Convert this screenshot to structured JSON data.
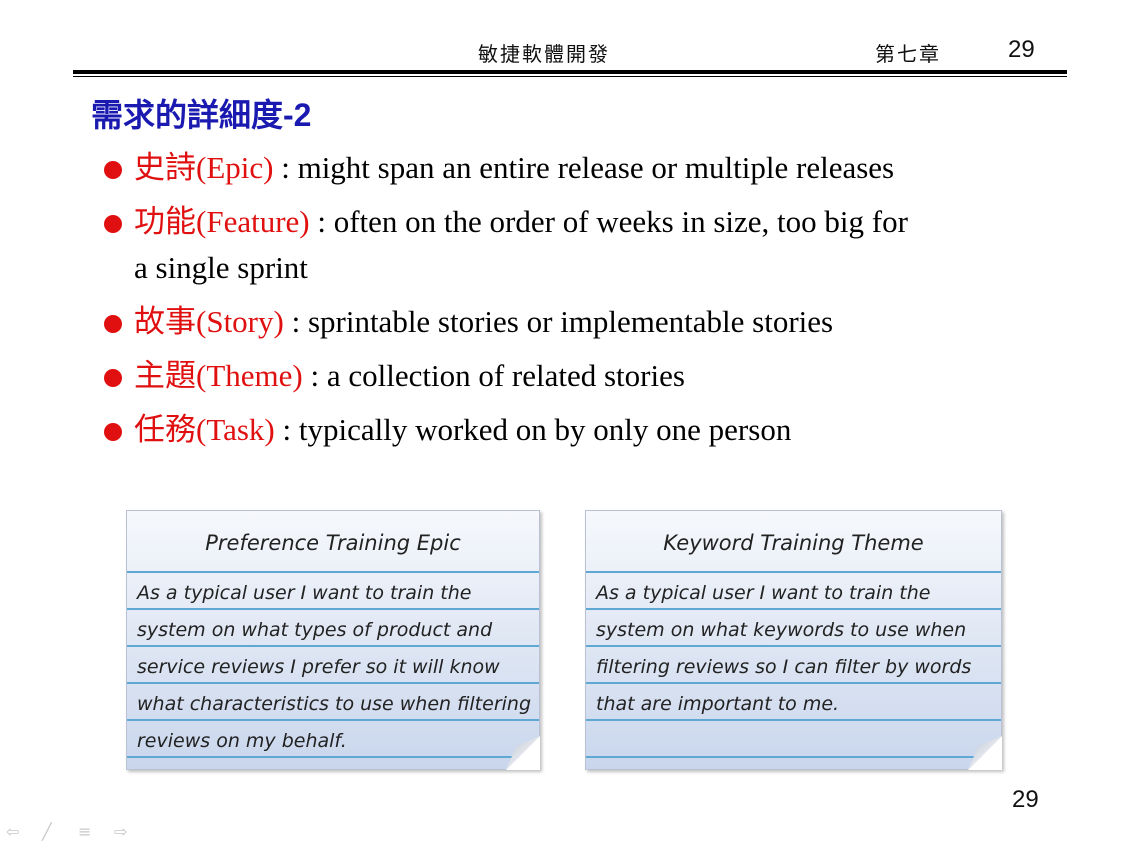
{
  "header": {
    "course_title": "敏捷軟體開發",
    "chapter": "第七章",
    "page_number": "29"
  },
  "slide": {
    "title_text": "需求的詳細度",
    "title_suffix": "-2",
    "bullets": [
      {
        "term": "史詩(Epic)",
        "text": " : might span an entire release or multiple releases"
      },
      {
        "term": "功能(Feature)",
        "text": " : often on the order of weeks in size, too big for",
        "continuation": "a single sprint"
      },
      {
        "term": "故事(Story)",
        "text": " : sprintable stories or implementable stories"
      },
      {
        "term": "主題(Theme)",
        "text": " : a collection of related stories"
      },
      {
        "term": "任務(Task)",
        "text": " : typically worked on by only one person"
      }
    ]
  },
  "cards": [
    {
      "title": "Preference Training Epic",
      "lines": [
        "As a typical user I want to train the",
        "system on what types of product and",
        "service reviews I prefer so it will know",
        "what characteristics to use when filtering",
        "reviews on my behalf."
      ]
    },
    {
      "title": "Keyword Training Theme",
      "lines": [
        "As a typical user I want to train the",
        "system on what keywords to use when",
        "filtering reviews so I can filter by words",
        "that are important to me.",
        ""
      ]
    }
  ],
  "footer": {
    "page_number": "29"
  },
  "colors": {
    "title": "#1a1ab0",
    "term": "#e01010",
    "bullet": "#e01010",
    "card_line": "#5fa8d4"
  },
  "nav_icons": [
    "previous-arrow-icon",
    "pen-icon",
    "menu-icon",
    "next-arrow-icon"
  ]
}
